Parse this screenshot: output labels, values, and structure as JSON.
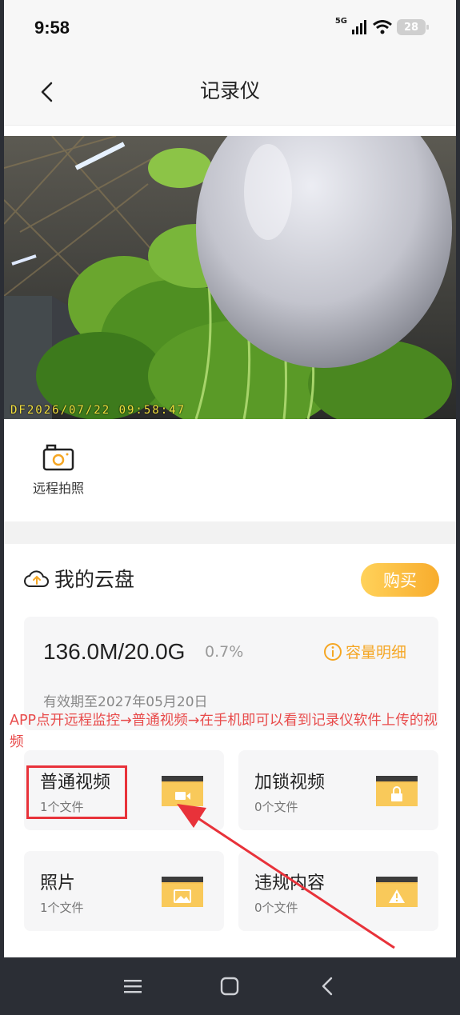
{
  "status_bar": {
    "time": "9:58",
    "network": "5G",
    "battery": "28"
  },
  "header": {
    "title": "记录仪"
  },
  "camera": {
    "timestamp": "DF2026/07/22 09:58:47"
  },
  "actions": {
    "remote_photo_label": "远程拍照"
  },
  "cloud": {
    "title": "我的云盘",
    "buy_label": "购买",
    "storage_used": "136.0M/20.0G",
    "storage_percent": "0.7%",
    "capacity_detail_label": "容量明细",
    "valid_until": "有效期至2027年05月20日"
  },
  "annotation": {
    "text": "APP点开远程监控→普通视频→在手机即可以看到记录仪软件上传的视频"
  },
  "tiles": [
    {
      "title": "普通视频",
      "count": "1个文件",
      "icon": "video-folder-icon"
    },
    {
      "title": "加锁视频",
      "count": "0个文件",
      "icon": "lock-folder-icon"
    },
    {
      "title": "照片",
      "count": "1个文件",
      "icon": "image-folder-icon"
    },
    {
      "title": "违规内容",
      "count": "0个文件",
      "icon": "warning-folder-icon"
    }
  ],
  "colors": {
    "accent": "#f8ac2d",
    "annotation": "#e84b4b",
    "highlight": "#e8323a"
  }
}
